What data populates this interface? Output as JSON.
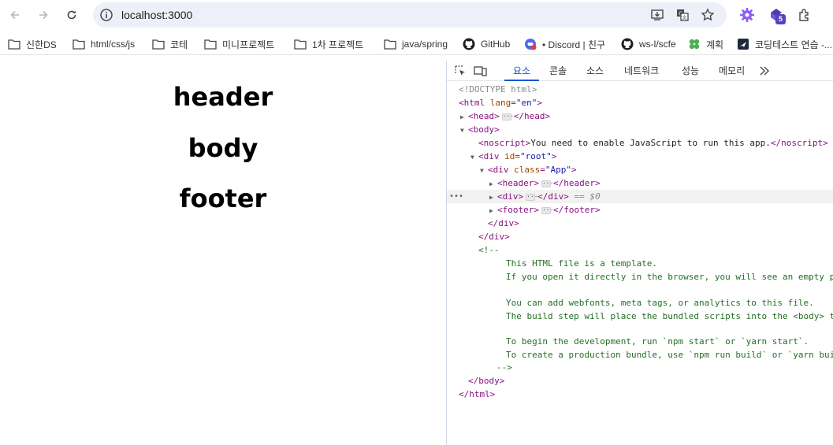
{
  "browser": {
    "url": "localhost:3000",
    "extension_badge": "5"
  },
  "bookmarks": [
    {
      "label": "신한DS",
      "icon": "folder-icon"
    },
    {
      "label": "html/css/js",
      "icon": "folder-icon"
    },
    {
      "label": "코테",
      "icon": "folder-icon"
    },
    {
      "label": "미니프로젝트",
      "icon": "folder-icon"
    },
    {
      "label": "1차 프로젝트",
      "icon": "folder-icon"
    },
    {
      "label": "java/spring",
      "icon": "folder-icon"
    },
    {
      "label": "GitHub",
      "icon": "github-icon"
    },
    {
      "label": "• Discord | 친구",
      "icon": "discord-icon"
    },
    {
      "label": "ws-l/scfe",
      "icon": "github-icon"
    },
    {
      "label": "계획",
      "icon": "clover-icon"
    },
    {
      "label": "코딩테스트 연습 -...",
      "icon": "programmers-icon"
    }
  ],
  "page": {
    "header": "header",
    "body": "body",
    "footer": "footer"
  },
  "devtools": {
    "tabs": [
      "요소",
      "콘솔",
      "소스",
      "네트워크",
      "성능",
      "메모리"
    ],
    "active_tab": "요소",
    "tree": {
      "doctype": "<!DOCTYPE html>",
      "html_open_tag": "<html",
      "html_lang_attr": "lang",
      "html_lang_val": "\"en\"",
      "html_open_close": ">",
      "head_open": "<head>",
      "head_close": "</head>",
      "body_open": "<body>",
      "noscript_open": "<noscript>",
      "noscript_text": "You need to enable JavaScript to run this app.",
      "noscript_close": "</noscript>",
      "div_root_open": "<div",
      "div_root_attr": "id",
      "div_root_val": "\"root\"",
      "div_root_close_bracket": ">",
      "div_app_open": "<div",
      "div_app_attr": "class",
      "div_app_val": "\"App\"",
      "div_app_close_bracket": ">",
      "header_open": "<header>",
      "header_close": "</header>",
      "div_open": "<div>",
      "div_close": "</div>",
      "selected_marker": "== $0",
      "footer_open": "<footer>",
      "footer_close": "</footer>",
      "div_end": "</div>",
      "div_end2": "</div>",
      "comment_open": "<!--",
      "comment_lines": [
        "This HTML file is a template.",
        "If you open it directly in the browser, you will see an empty page.",
        "",
        "You can add webfonts, meta tags, or analytics to this file.",
        "The build step will place the bundled scripts into the <body> tag.",
        "",
        "To begin the development, run `npm start` or `yarn start`.",
        "To create a production bundle, use `npm run build` or `yarn build`."
      ],
      "comment_close": "-->",
      "body_close": "</body>",
      "html_close": "</html>"
    }
  },
  "colors": {
    "tag": "#881280",
    "attr_name": "#994500",
    "attr_value": "#1a1aa6",
    "comment": "#236e25",
    "active_tab": "#0b57d0"
  }
}
